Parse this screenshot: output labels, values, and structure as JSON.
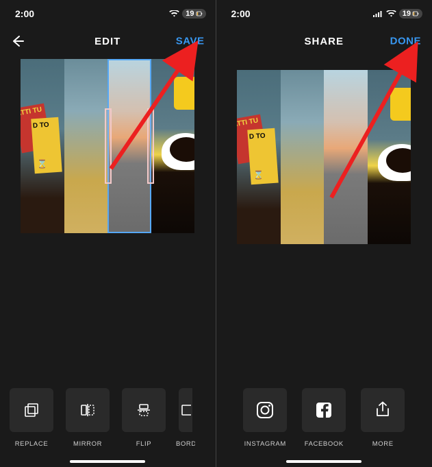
{
  "status": {
    "time": "2:00",
    "battery_percent": "19"
  },
  "left": {
    "title": "EDIT",
    "action": "SAVE",
    "crop_frame": {
      "left_pct": 50,
      "width_pct": 25
    },
    "tools": [
      {
        "label": "REPLACE",
        "icon": "replace-icon"
      },
      {
        "label": "MIRROR",
        "icon": "mirror-icon"
      },
      {
        "label": "FLIP",
        "icon": "flip-icon"
      },
      {
        "label": "BORDER",
        "icon": "border-icon"
      }
    ]
  },
  "right": {
    "title": "SHARE",
    "action": "DONE",
    "share": [
      {
        "label": "INSTAGRAM",
        "icon": "instagram-icon"
      },
      {
        "label": "FACEBOOK",
        "icon": "facebook-icon"
      },
      {
        "label": "MORE",
        "icon": "share-more-icon"
      }
    ]
  },
  "collage": {
    "book_red_text": "ATTI\nTU",
    "book_yellow_text": "D\nTO"
  },
  "annotation": {
    "color": "#ec2020",
    "description": "red arrows pointing to SAVE and DONE actions"
  }
}
